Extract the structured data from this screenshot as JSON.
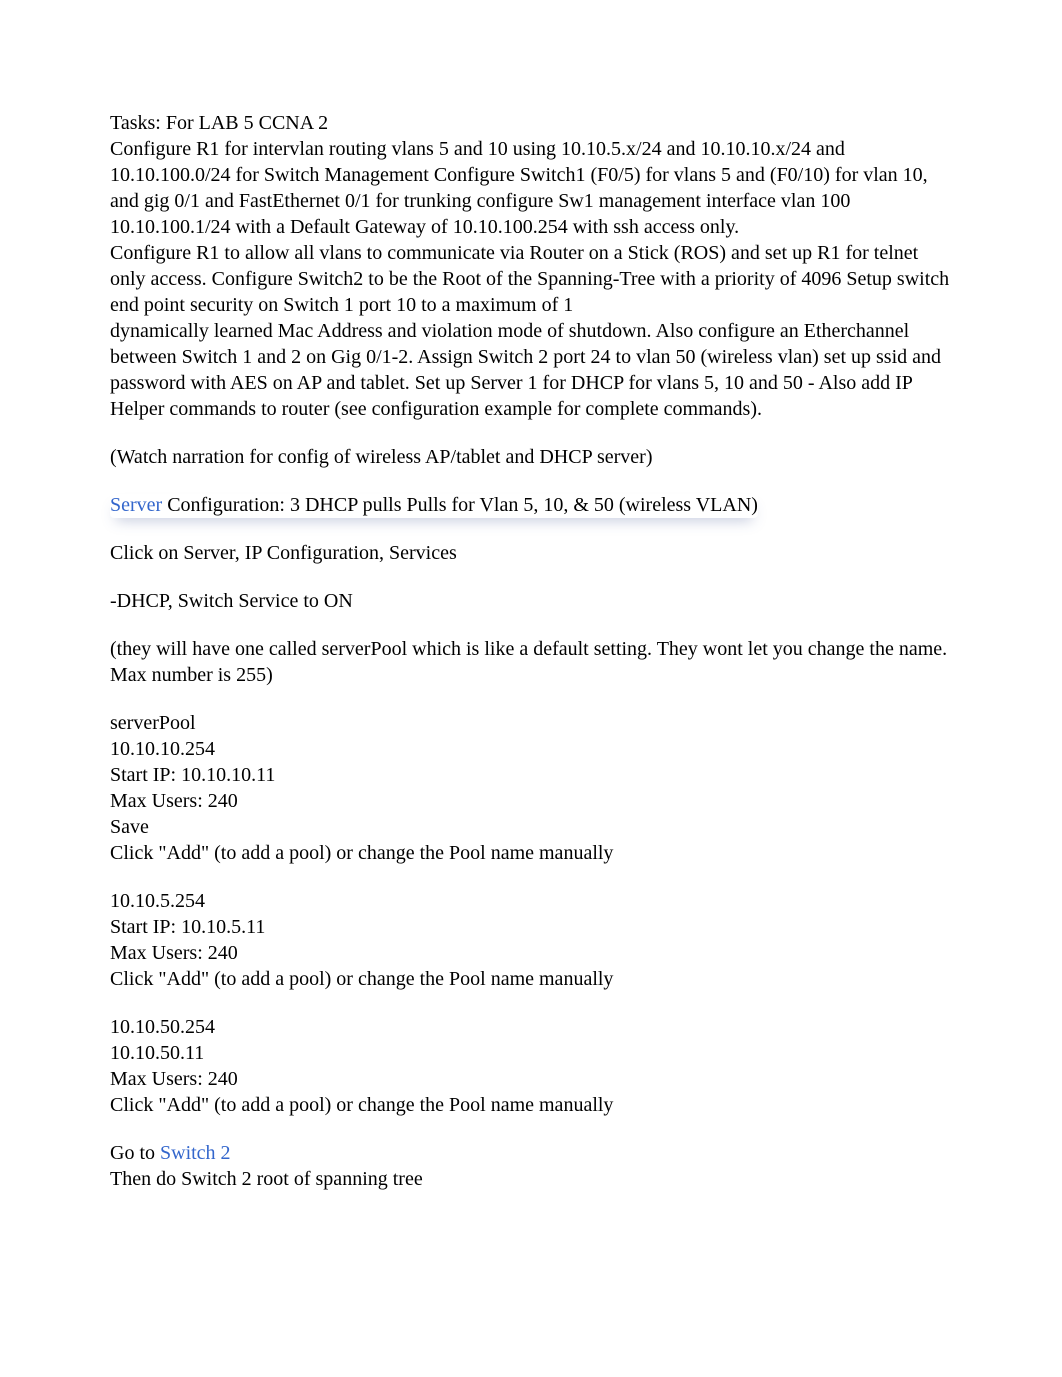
{
  "title": "Tasks: For LAB 5 CCNA 2",
  "intro_block": [
    "Configure R1 for intervlan routing vlans 5 and 10 using 10.10.5.x/24 and 10.10.10.x/24 and 10.10.100.0/24 for Switch Management Configure Switch1 (F0/5) for vlans 5 and (F0/10) for vlan 10, and gig 0/1 and FastEthernet 0/1 for trunking configure Sw1 management interface vlan 100 10.10.100.1/24 with a Default Gateway of 10.10.100.254 with ssh access only.",
    "Configure R1 to allow all vlans to communicate via Router on a Stick (ROS) and set up R1 for telnet only access. Configure Switch2 to be the Root of the Spanning-Tree with a priority of 4096 Setup switch end point security on Switch 1 port 10 to a maximum of 1",
    "dynamically learned Mac Address and violation mode of shutdown. Also configure an Etherchannel between Switch 1 and 2 on Gig 0/1-2. Assign Switch 2 port 24 to vlan 50 (wireless vlan) set up ssid and password with AES on AP and tablet.  Set up Server 1 for DHCP for vlans 5, 10 and 50 - Also add IP Helper commands to router (see configuration example for complete commands)."
  ],
  "watch_note": "(Watch narration for config of wireless AP/tablet and DHCP server)",
  "server_label": "Server",
  "server_config_rest": " Configuration: 3 DHCP pulls Pulls for Vlan 5, 10, & 50 (wireless VLAN)",
  "click_server": "Click on Server, IP Configuration, Services",
  "dhcp_on": "-DHCP, Switch Service to ON",
  "pool_note": "(they will have one called serverPool which is like a default setting. They wont let you change the name. Max number is 255)",
  "pool1": {
    "name": "serverPool",
    "gateway": "10.10.10.254",
    "start": "Start IP: 10.10.10.11",
    "max": "Max Users: 240",
    "save": "Save",
    "add": "Click \"Add\" (to add a pool) or change the Pool name manually"
  },
  "pool2": {
    "gateway": "10.10.5.254",
    "start": "Start IP: 10.10.5.11",
    "max": "Max Users: 240",
    "add": "Click \"Add\" (to add a pool) or change the Pool name manually"
  },
  "pool3": {
    "gateway": "10.10.50.254",
    "start": "10.10.50.11",
    "max": "Max Users: 240",
    "add": "Click \"Add\" (to add a pool) or change the Pool name manually"
  },
  "goto_prefix": "Go to ",
  "switch2_label": "Switch 2",
  "switch2_line": "Then do Switch 2 root of spanning tree"
}
